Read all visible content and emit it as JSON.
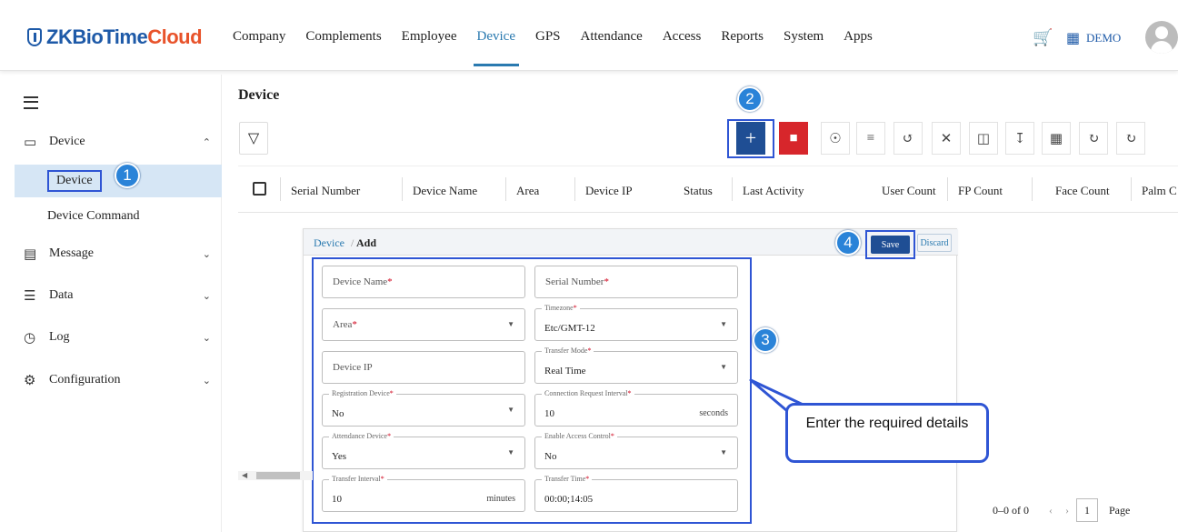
{
  "app": {
    "logo_main": "ZKBioTime",
    "logo_accent": "Cloud"
  },
  "nav": {
    "items": [
      "Company",
      "Complements",
      "Employee",
      "Device",
      "GPS",
      "Attendance",
      "Access",
      "Reports",
      "System",
      "Apps"
    ],
    "active": "Device",
    "org_label": "DEMO"
  },
  "sidebar": {
    "group_label": "Device",
    "sub_items": [
      "Device",
      "Device Command"
    ],
    "sections": [
      "Message",
      "Data",
      "Log",
      "Configuration"
    ]
  },
  "main": {
    "page_title": "Device",
    "columns": [
      "Serial Number",
      "Device Name",
      "Area",
      "Device IP",
      "Status",
      "Last Activity",
      "User Count",
      "FP Count",
      "Face Count",
      "Palm C"
    ]
  },
  "dialog": {
    "breadcrumb_parent": "Device",
    "breadcrumb_sep": "/",
    "breadcrumb_current": "Add",
    "save_label": "Save",
    "discard_label": "Discard",
    "fields": {
      "device_name": "Device Name",
      "serial_number": "Serial Number",
      "area": "Area",
      "timezone_label": "Timezone",
      "timezone_value": "Etc/GMT-12",
      "device_ip": "Device IP",
      "transfer_mode_label": "Transfer Mode",
      "transfer_mode_value": "Real Time",
      "registration_label": "Registration Device",
      "registration_value": "No",
      "conn_interval_label": "Connection Request Interval",
      "conn_interval_value": "10",
      "conn_interval_unit": "seconds",
      "attendance_label": "Attendance Device",
      "attendance_value": "Yes",
      "access_control_label": "Enable Access Control",
      "access_control_value": "No",
      "transfer_interval_label": "Transfer Interval",
      "transfer_interval_value": "10",
      "transfer_interval_unit": "minutes",
      "transfer_time_label": "Transfer Time",
      "transfer_time_value": "00:00;14:05"
    },
    "required_mark": "*"
  },
  "annotations": {
    "steps": [
      "1",
      "2",
      "3",
      "4"
    ],
    "callout_text": "Enter the required details"
  },
  "pager": {
    "summary": "0–0 of 0",
    "page": "1",
    "page_label": "Page"
  },
  "colors": {
    "brand": "#1e5aa8",
    "accent": "#e8532b",
    "primary_button": "#1f4e94",
    "danger_button": "#d7262b",
    "annotation": "#2f55d4",
    "badge": "#2a83d8"
  }
}
